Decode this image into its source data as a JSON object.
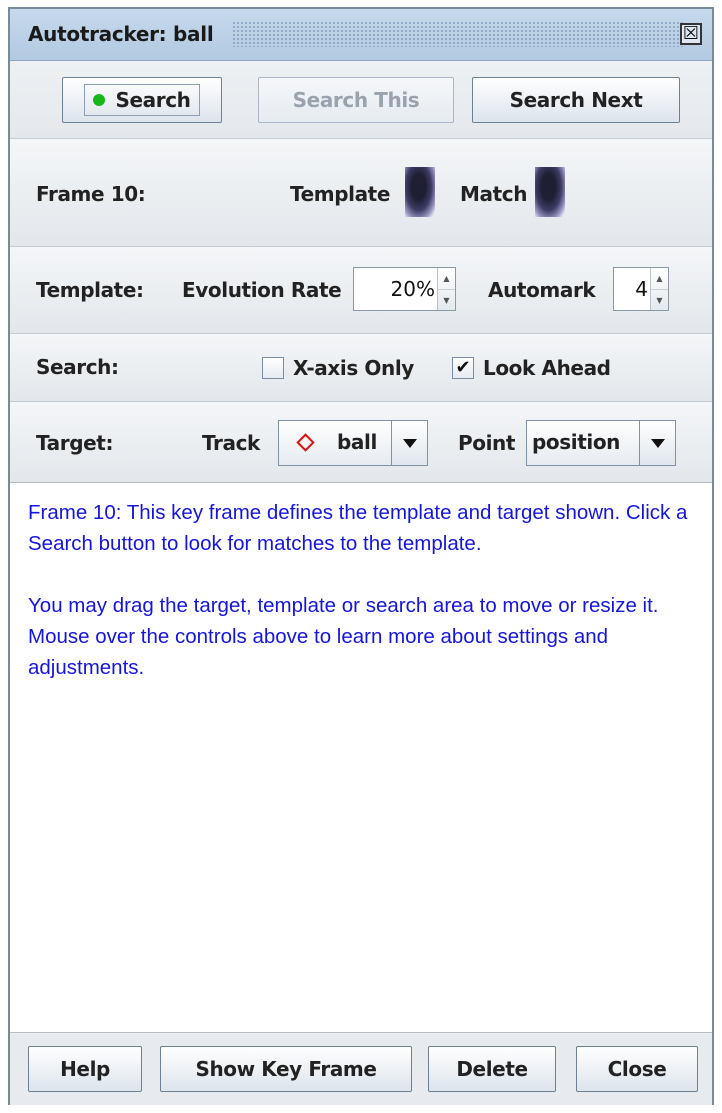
{
  "window": {
    "title": "Autotracker: ball",
    "close_glyph": "☒"
  },
  "search_buttons": {
    "search": "Search",
    "search_this": "Search This",
    "search_next": "Search Next",
    "search_status_color": "#18b818"
  },
  "frame_row": {
    "frame_label": "Frame 10:",
    "template_label": "Template",
    "match_label": "Match"
  },
  "template_row": {
    "label": "Template:",
    "evolution_label": "Evolution Rate",
    "evolution_value": "20%",
    "automark_label": "Automark",
    "automark_value": "4"
  },
  "search_row": {
    "label": "Search:",
    "xaxis_label": "X-axis Only",
    "xaxis_checked": false,
    "lookahead_label": "Look Ahead",
    "lookahead_checked": true,
    "check_glyph": "✔"
  },
  "target_row": {
    "label": "Target:",
    "track_label": "Track",
    "track_value": "ball",
    "track_icon_color": "#e01010",
    "point_label": "Point",
    "point_value": "position"
  },
  "message": {
    "paragraph1": "Frame 10: This key frame defines the template and target shown. Click a Search button to look for matches to the template.",
    "paragraph2": "You may drag the target, template or search area to move or resize it.  Mouse over the controls above to learn more about settings and adjustments.",
    "text_color": "#1515e0"
  },
  "footer": {
    "help": "Help",
    "show_key_frame": "Show Key Frame",
    "delete": "Delete",
    "close": "Close"
  }
}
